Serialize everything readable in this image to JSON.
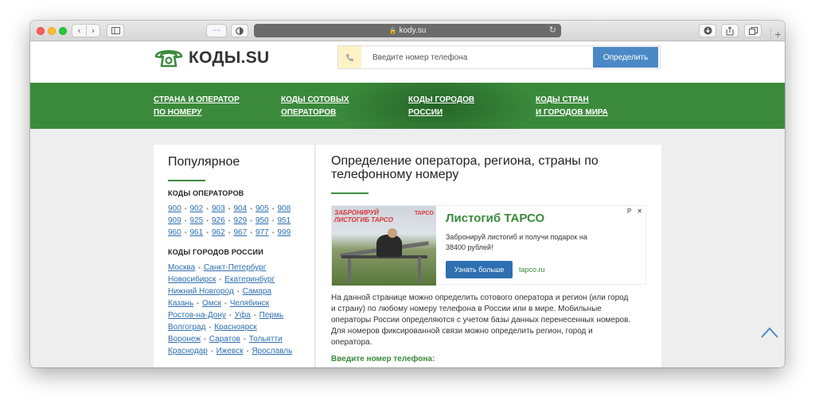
{
  "browser": {
    "url": "kody.su",
    "reader_icon": "····"
  },
  "site": {
    "logo_text": "КОДЫ.SU",
    "search": {
      "placeholder": "Введите номер телефона",
      "button_label": "Определить"
    }
  },
  "nav": [
    {
      "line1": "Страна и оператор",
      "line2": "по номеру"
    },
    {
      "line1": "Коды сотовых",
      "line2": "операторов"
    },
    {
      "line1": "Коды городов",
      "line2": "России"
    },
    {
      "line1": "Коды стран",
      "line2": "и городов мира"
    }
  ],
  "sidebar": {
    "title": "Популярное",
    "operators_heading": "КОДЫ ОПЕРАТОРОВ",
    "operator_codes": [
      "900",
      "902",
      "903",
      "904",
      "905",
      "908",
      "909",
      "925",
      "926",
      "929",
      "950",
      "951",
      "960",
      "961",
      "962",
      "967",
      "977",
      "999"
    ],
    "cities_heading": "КОДЫ ГОРОДОВ РОССИИ",
    "cities": [
      [
        "Москва",
        "Санкт-Петербург"
      ],
      [
        "Новосибирск",
        "Екатеринбург"
      ],
      [
        "Нижний Новгород",
        "Самара"
      ],
      [
        "Казань",
        "Омск",
        "Челябинск"
      ],
      [
        "Ростов-на-Дону",
        "Уфа",
        "Пермь"
      ],
      [
        "Волгоград",
        "Красноярск"
      ],
      [
        "Воронеж",
        "Саратов",
        "Тольятти"
      ],
      [
        "Краснодар",
        "Ижевск",
        "Ярославль"
      ]
    ]
  },
  "main": {
    "title": "Определение оператора, региона, страны по телефонному номеру",
    "ad": {
      "image_caption": "ЗАБРОНИРУЙ",
      "image_caption_2": "ЛИСТОГИБ ТАРСО",
      "image_brand": "TAPCO",
      "title": "Листогиб ТАРСО",
      "text": "Забронируй листогиб и получи подарок на 38400 рублей!",
      "button_label": "Узнать больше",
      "domain": "tapco.ru",
      "badge": "P",
      "close": "✕"
    },
    "description": "На данной странице можно определить сотового оператора и регион (или город и страну) по любому номеру телефона в России или в мире. Мобильные операторы России определяются с учетом базы данных перенесенных номеров. Для номеров фиксированной связи можно определить регион, город и оператора.",
    "enter_label": "Введите номер телефона:"
  },
  "colors": {
    "brand_green": "#3b8a3c",
    "link_blue": "#2d6fb0",
    "button_blue": "#4a89c5"
  }
}
